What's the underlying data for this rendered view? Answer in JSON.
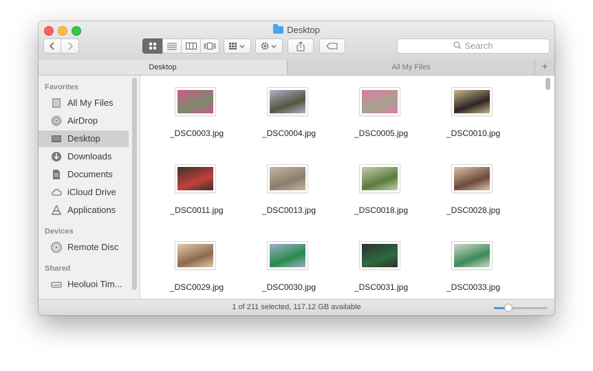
{
  "window": {
    "title": "Desktop"
  },
  "toolbar": {
    "back_icon": "chevron-left-icon",
    "forward_icon": "chevron-right-icon",
    "view_modes": [
      "icon-view-icon",
      "list-view-icon",
      "column-view-icon",
      "cover-flow-icon"
    ],
    "search_placeholder": "Search"
  },
  "tabs": [
    {
      "label": "Desktop",
      "active": true
    },
    {
      "label": "All My Files",
      "active": false
    }
  ],
  "sidebar": {
    "sections": [
      {
        "heading": "Favorites",
        "items": [
          {
            "label": "All My Files",
            "icon": "all-files-icon"
          },
          {
            "label": "AirDrop",
            "icon": "airdrop-icon"
          },
          {
            "label": "Desktop",
            "icon": "desktop-icon",
            "selected": true
          },
          {
            "label": "Downloads",
            "icon": "downloads-icon"
          },
          {
            "label": "Documents",
            "icon": "documents-icon"
          },
          {
            "label": "iCloud Drive",
            "icon": "cloud-icon"
          },
          {
            "label": "Applications",
            "icon": "applications-icon"
          }
        ]
      },
      {
        "heading": "Devices",
        "items": [
          {
            "label": "Remote Disc",
            "icon": "disc-icon"
          }
        ]
      },
      {
        "heading": "Shared",
        "items": [
          {
            "label": "Heoluoi Tim...",
            "icon": "network-drive-icon"
          }
        ]
      }
    ]
  },
  "files": [
    {
      "name": "_DSC0003.jpg",
      "colors": [
        "#7b8a6a",
        "#c95a8a"
      ]
    },
    {
      "name": "_DSC0004.jpg",
      "colors": [
        "#4f5a3d",
        "#b9a9c7"
      ]
    },
    {
      "name": "_DSC0005.jpg",
      "colors": [
        "#a4a48e",
        "#e079a8"
      ]
    },
    {
      "name": "_DSC0010.jpg",
      "colors": [
        "#2c2622",
        "#c9b58a"
      ]
    },
    {
      "name": "_DSC0011.jpg",
      "colors": [
        "#c2413b",
        "#3e2f2c"
      ]
    },
    {
      "name": "_DSC0013.jpg",
      "colors": [
        "#8c7d6b",
        "#c5b6a2"
      ]
    },
    {
      "name": "_DSC0018.jpg",
      "colors": [
        "#5b7a3b",
        "#c0d0b0"
      ]
    },
    {
      "name": "_DSC0028.jpg",
      "colors": [
        "#6a4a3a",
        "#dcc2a6"
      ]
    },
    {
      "name": "_DSC0029.jpg",
      "colors": [
        "#8a6a50",
        "#e4c9a8"
      ]
    },
    {
      "name": "_DSC0030.jpg",
      "colors": [
        "#2a8a4a",
        "#9ab0cc"
      ]
    },
    {
      "name": "_DSC0031.jpg",
      "colors": [
        "#2d6b3d",
        "#303030"
      ]
    },
    {
      "name": "_DSC0033.jpg",
      "colors": [
        "#3b8a5a",
        "#d0d7c8"
      ]
    }
  ],
  "status": {
    "text": "1 of 211 selected, 117.12 GB available",
    "zoom_level": 0.27
  }
}
